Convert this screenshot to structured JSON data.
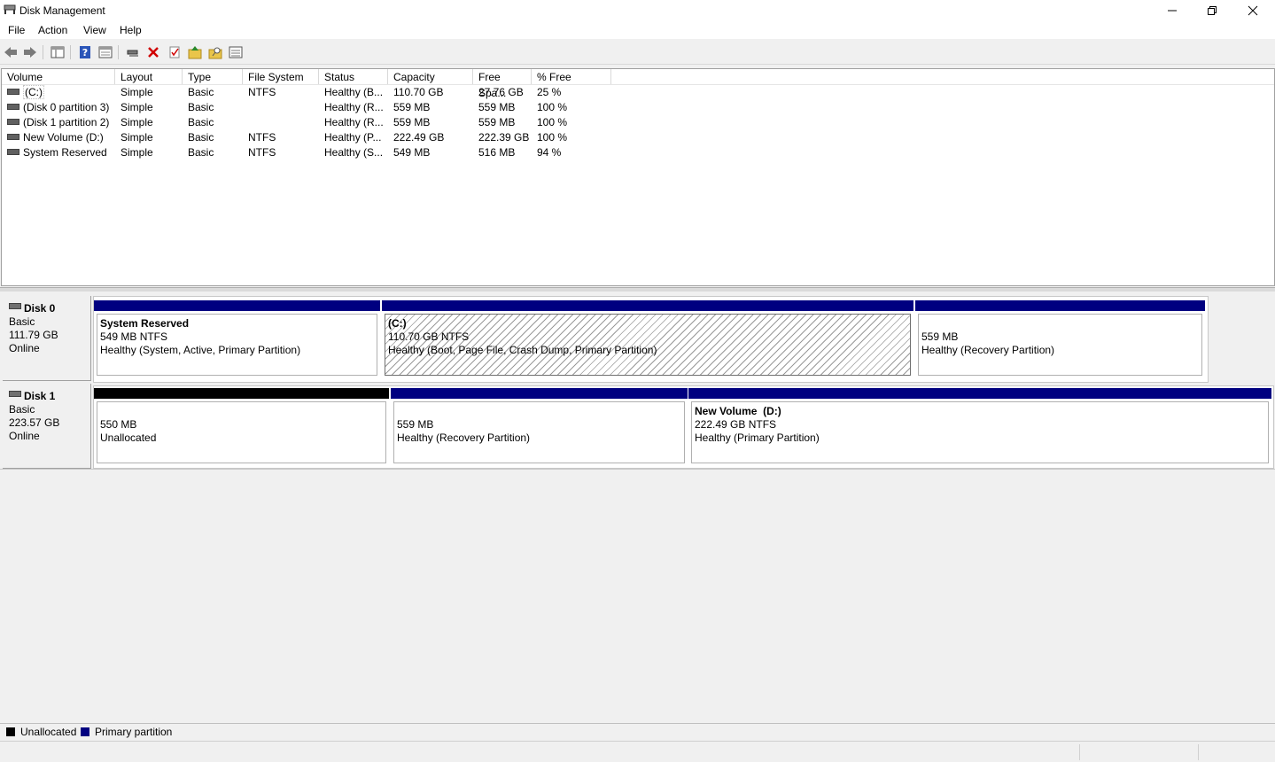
{
  "window": {
    "title": "Disk Management"
  },
  "menu": [
    "File",
    "Action",
    "View",
    "Help"
  ],
  "toolbar_icons": [
    "back-arrow-icon",
    "forward-arrow-icon",
    "console-tree-icon",
    "help-icon",
    "properties-icon",
    "connect-icon",
    "delete-icon",
    "check-icon",
    "folder-up-icon",
    "folder-search-icon",
    "list-view-icon"
  ],
  "volume_list": {
    "columns": [
      "Volume",
      "Layout",
      "Type",
      "File System",
      "Status",
      "Capacity",
      "Free Spa...",
      "% Free"
    ],
    "rows": [
      [
        "(C:)",
        "Simple",
        "Basic",
        "NTFS",
        "Healthy (B...",
        "110.70 GB",
        "27.76 GB",
        "25 %"
      ],
      [
        "(Disk 0 partition 3)",
        "Simple",
        "Basic",
        "",
        "Healthy (R...",
        "559 MB",
        "559 MB",
        "100 %"
      ],
      [
        "(Disk 1 partition 2)",
        "Simple",
        "Basic",
        "",
        "Healthy (R...",
        "559 MB",
        "559 MB",
        "100 %"
      ],
      [
        "New Volume (D:)",
        "Simple",
        "Basic",
        "NTFS",
        "Healthy (P...",
        "222.49 GB",
        "222.39 GB",
        "100 %"
      ],
      [
        "System Reserved",
        "Simple",
        "Basic",
        "NTFS",
        "Healthy (S...",
        "549 MB",
        "516 MB",
        "94 %"
      ]
    ]
  },
  "disks": [
    {
      "name": "Disk 0",
      "type": "Basic",
      "size": "111.79 GB",
      "status": "Online",
      "partitions": [
        {
          "title": "System Reserved",
          "size_fs": "549 MB NTFS",
          "status": "Healthy (System, Active, Primary Partition)",
          "kind": "primary"
        },
        {
          "title": "(C:)",
          "size_fs": "110.70 GB NTFS",
          "status": "Healthy (Boot, Page File, Crash Dump, Primary Partition)",
          "kind": "primary",
          "selected": true
        },
        {
          "title": "",
          "size_fs": "559 MB",
          "status": "Healthy (Recovery Partition)",
          "kind": "primary"
        }
      ]
    },
    {
      "name": "Disk 1",
      "type": "Basic",
      "size": "223.57 GB",
      "status": "Online",
      "partitions": [
        {
          "title": "",
          "size_fs": "550 MB",
          "status": "Unallocated",
          "kind": "unallocated"
        },
        {
          "title": "",
          "size_fs": "559 MB",
          "status": "Healthy (Recovery Partition)",
          "kind": "primary"
        },
        {
          "title": "New Volume  (D:)",
          "size_fs": "222.49 GB NTFS",
          "status": "Healthy (Primary Partition)",
          "kind": "primary"
        }
      ]
    }
  ],
  "legend": [
    {
      "label": "Unallocated",
      "color": "#000000"
    },
    {
      "label": "Primary partition",
      "color": "#000080"
    }
  ],
  "colors": {
    "primary": "#000080",
    "unallocated": "#000000"
  }
}
